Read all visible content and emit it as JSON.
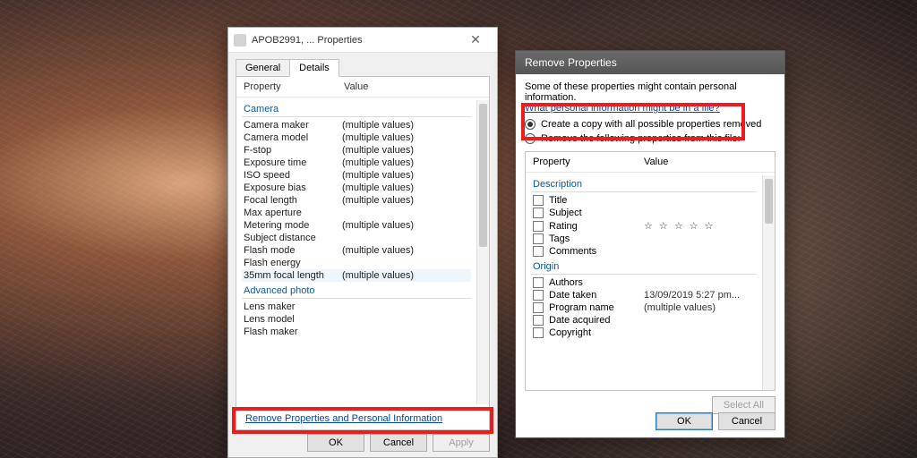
{
  "props": {
    "title": "APOB2991, ... Properties",
    "tabs": {
      "general": "General",
      "details": "Details"
    },
    "columns": {
      "property": "Property",
      "value": "Value"
    },
    "sections": {
      "camera": "Camera",
      "advanced_photo": "Advanced photo"
    },
    "rows": {
      "camera_maker": {
        "k": "Camera maker",
        "v": "(multiple values)"
      },
      "camera_model": {
        "k": "Camera model",
        "v": "(multiple values)"
      },
      "f_stop": {
        "k": "F-stop",
        "v": "(multiple values)"
      },
      "exposure_time": {
        "k": "Exposure time",
        "v": "(multiple values)"
      },
      "iso_speed": {
        "k": "ISO speed",
        "v": "(multiple values)"
      },
      "exposure_bias": {
        "k": "Exposure bias",
        "v": "(multiple values)"
      },
      "focal_length": {
        "k": "Focal length",
        "v": "(multiple values)"
      },
      "max_aperture": {
        "k": "Max aperture",
        "v": ""
      },
      "metering_mode": {
        "k": "Metering mode",
        "v": "(multiple values)"
      },
      "subject_distance": {
        "k": "Subject distance",
        "v": ""
      },
      "flash_mode": {
        "k": "Flash mode",
        "v": "(multiple values)"
      },
      "flash_energy": {
        "k": "Flash energy",
        "v": ""
      },
      "focal_35mm": {
        "k": "35mm focal length",
        "v": "(multiple values)"
      },
      "lens_maker": {
        "k": "Lens maker",
        "v": ""
      },
      "lens_model": {
        "k": "Lens model",
        "v": ""
      },
      "flash_maker": {
        "k": "Flash maker",
        "v": ""
      }
    },
    "remove_link": "Remove Properties and Personal Information",
    "buttons": {
      "ok": "OK",
      "cancel": "Cancel",
      "apply": "Apply"
    }
  },
  "remove": {
    "title": "Remove Properties",
    "hint": "Some of these properties might contain personal information.",
    "hint_link": "What personal information might be in a file?",
    "radio1": "Create a copy with all possible properties removed",
    "radio2": "Remove the following properties from this file:",
    "columns": {
      "property": "Property",
      "value": "Value"
    },
    "sections": {
      "description": "Description",
      "origin": "Origin"
    },
    "rows": {
      "title": {
        "k": "Title",
        "v": ""
      },
      "subject": {
        "k": "Subject",
        "v": ""
      },
      "rating": {
        "k": "Rating",
        "v": "☆ ☆ ☆ ☆ ☆"
      },
      "tags": {
        "k": "Tags",
        "v": ""
      },
      "comments": {
        "k": "Comments",
        "v": ""
      },
      "authors": {
        "k": "Authors",
        "v": ""
      },
      "date_taken": {
        "k": "Date taken",
        "v": "13/09/2019 5:27 pm..."
      },
      "program_name": {
        "k": "Program name",
        "v": "(multiple values)"
      },
      "date_acquired": {
        "k": "Date acquired",
        "v": ""
      },
      "copyright": {
        "k": "Copyright",
        "v": ""
      }
    },
    "select_all": "Select All",
    "buttons": {
      "ok": "OK",
      "cancel": "Cancel"
    }
  }
}
